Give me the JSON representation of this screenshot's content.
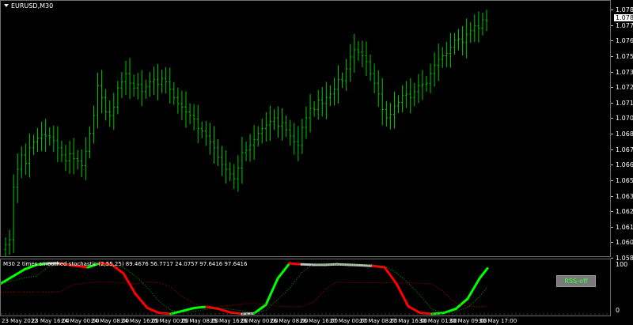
{
  "window": {
    "symbol": "EURUSD,M30"
  },
  "price_axis": {
    "labels": [
      "1.07895",
      "1.07765",
      "1.07640",
      "1.07515",
      "1.07390",
      "1.07260",
      "1.07135",
      "1.07010",
      "1.06885",
      "1.06755",
      "1.06630",
      "1.06505",
      "1.06380",
      "1.06250",
      "1.06125",
      "1.06005",
      "1.05880"
    ],
    "current_price": "1.07837"
  },
  "indicator": {
    "title": "M30 2 times smoothed stochastic (2,55,25) 89.4676 56.7717 24.0757 97.6416 97.6416",
    "axis_labels": [
      "100",
      "0"
    ],
    "button_label": "RSS-off"
  },
  "time_axis": {
    "labels": [
      "23 May 2022",
      "23 May 16:00",
      "24 May 00:00",
      "24 May 08:00",
      "24 May 16:00",
      "25 May 00:00",
      "25 May 08:00",
      "25 May 16:00",
      "26 May 00:00",
      "26 May 08:00",
      "26 May 16:00",
      "27 May 00:00",
      "27 May 08:00",
      "27 May 16:00",
      "30 May 01:00",
      "30 May 09:00",
      "30 May 17:00"
    ]
  },
  "colors": {
    "background": "#000000",
    "bars": "#00c800",
    "stoch_up": "#00ff00",
    "stoch_down": "#ff0000",
    "stoch_neutral": "#c0c0c0",
    "signal_green": "#00a000",
    "signal_red": "#b00000",
    "grid": "#6e6e6e"
  },
  "chart_data": {
    "type": "bar",
    "title": "EURUSD,M30",
    "ylim": [
      1.0586,
      1.0793
    ],
    "closes": [
      1.0597,
      1.0601,
      1.0645,
      1.066,
      1.0672,
      1.0665,
      1.0678,
      1.0683,
      1.0686,
      1.0689,
      1.0688,
      1.0687,
      1.0684,
      1.0678,
      1.0672,
      1.0667,
      1.0673,
      1.0669,
      1.0667,
      1.0663,
      1.0675,
      1.069,
      1.0705,
      1.073,
      1.072,
      1.0708,
      1.0705,
      1.0712,
      1.0728,
      1.0733,
      1.074,
      1.0732,
      1.0728,
      1.0731,
      1.0725,
      1.0729,
      1.0733,
      1.0735,
      1.0731,
      1.0736,
      1.0733,
      1.0727,
      1.072,
      1.0715,
      1.0712,
      1.0708,
      1.0705,
      1.0702,
      1.0694,
      1.0692,
      1.0688,
      1.0683,
      1.0678,
      1.067,
      1.0664,
      1.066,
      1.0656,
      1.0652,
      1.0661,
      1.0674,
      1.0676,
      1.068,
      1.0685,
      1.069,
      1.0694,
      1.0697,
      1.07,
      1.0703,
      1.0696,
      1.0699,
      1.0693,
      1.0688,
      1.0683,
      1.068,
      1.0695,
      1.0703,
      1.0711,
      1.071,
      1.0718,
      1.0715,
      1.072,
      1.0723,
      1.0727,
      1.0735,
      1.0734,
      1.0744,
      1.0754,
      1.076,
      1.0758,
      1.0755,
      1.075,
      1.074,
      1.0732,
      1.0723,
      1.071,
      1.0703,
      1.0706,
      1.0713,
      1.0716,
      1.0722,
      1.0723,
      1.072,
      1.0725,
      1.073,
      1.0731,
      1.0732,
      1.074,
      1.0747,
      1.0752,
      1.0755,
      1.0757,
      1.0762,
      1.0768,
      1.0769,
      1.0766,
      1.0773,
      1.0776,
      1.078,
      1.0778,
      1.0785,
      1.0784
    ]
  }
}
